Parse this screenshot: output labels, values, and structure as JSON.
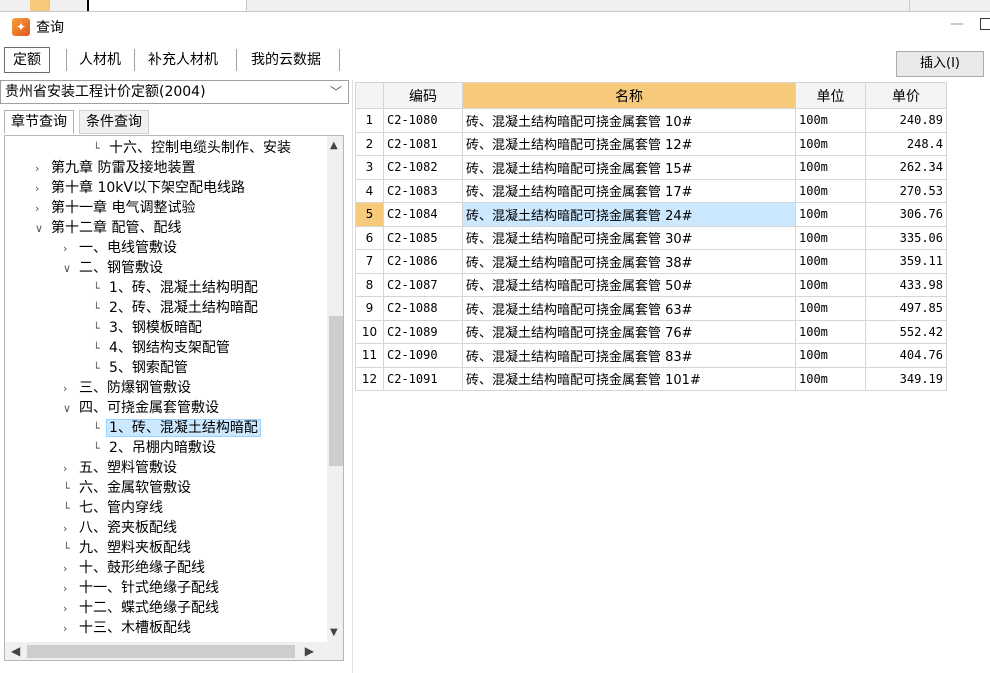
{
  "window": {
    "title": "查询"
  },
  "tabs": [
    "定额",
    "人材机",
    "补充人材机",
    "我的云数据"
  ],
  "insert_button": "插入(I)",
  "dropdown": {
    "value": "贵州省安装工程计价定额(2004)"
  },
  "subtabs": [
    "章节查询",
    "条件查询"
  ],
  "tree": [
    {
      "label": "十六、控制电缆头制作、安装",
      "indent": 3,
      "expander": ""
    },
    {
      "label": "第九章 防雷及接地装置",
      "indent": 1,
      "expander": ">"
    },
    {
      "label": "第十章 10kV以下架空配电线路",
      "indent": 1,
      "expander": ">"
    },
    {
      "label": "第十一章 电气调整试验",
      "indent": 1,
      "expander": ">"
    },
    {
      "label": "第十二章 配管、配线",
      "indent": 1,
      "expander": "v"
    },
    {
      "label": "一、电线管敷设",
      "indent": 2,
      "expander": ">"
    },
    {
      "label": "二、钢管敷设",
      "indent": 2,
      "expander": "v"
    },
    {
      "label": "1、砖、混凝土结构明配",
      "indent": 3,
      "expander": ""
    },
    {
      "label": "2、砖、混凝土结构暗配",
      "indent": 3,
      "expander": ""
    },
    {
      "label": "3、钢模板暗配",
      "indent": 3,
      "expander": ""
    },
    {
      "label": "4、钢结构支架配管",
      "indent": 3,
      "expander": ""
    },
    {
      "label": "5、钢索配管",
      "indent": 3,
      "expander": ""
    },
    {
      "label": "三、防爆钢管敷设",
      "indent": 2,
      "expander": ">"
    },
    {
      "label": "四、可挠金属套管敷设",
      "indent": 2,
      "expander": "v"
    },
    {
      "label": "1、砖、混凝土结构暗配",
      "indent": 3,
      "expander": "",
      "selected": true
    },
    {
      "label": "2、吊棚内暗敷设",
      "indent": 3,
      "expander": ""
    },
    {
      "label": "五、塑料管敷设",
      "indent": 2,
      "expander": ">"
    },
    {
      "label": "六、金属软管敷设",
      "indent": 2,
      "expander": ""
    },
    {
      "label": "七、管内穿线",
      "indent": 2,
      "expander": ""
    },
    {
      "label": "八、瓷夹板配线",
      "indent": 2,
      "expander": ">"
    },
    {
      "label": "九、塑料夹板配线",
      "indent": 2,
      "expander": ""
    },
    {
      "label": "十、鼓形绝缘子配线",
      "indent": 2,
      "expander": ">"
    },
    {
      "label": "十一、针式绝缘子配线",
      "indent": 2,
      "expander": ">"
    },
    {
      "label": "十二、蝶式绝缘子配线",
      "indent": 2,
      "expander": ">"
    },
    {
      "label": "十三、木槽板配线",
      "indent": 2,
      "expander": ">"
    }
  ],
  "table": {
    "headers": [
      "编码",
      "名称",
      "单位",
      "单价"
    ],
    "rows": [
      {
        "n": "1",
        "code": "C2-1080",
        "name": "砖、混凝土结构暗配可挠金属套管 10#",
        "unit": "100m",
        "price": "240.89"
      },
      {
        "n": "2",
        "code": "C2-1081",
        "name": "砖、混凝土结构暗配可挠金属套管 12#",
        "unit": "100m",
        "price": "248.4"
      },
      {
        "n": "3",
        "code": "C2-1082",
        "name": "砖、混凝土结构暗配可挠金属套管 15#",
        "unit": "100m",
        "price": "262.34"
      },
      {
        "n": "4",
        "code": "C2-1083",
        "name": "砖、混凝土结构暗配可挠金属套管 17#",
        "unit": "100m",
        "price": "270.53"
      },
      {
        "n": "5",
        "code": "C2-1084",
        "name": "砖、混凝土结构暗配可挠金属套管 24#",
        "unit": "100m",
        "price": "306.76",
        "selected": true
      },
      {
        "n": "6",
        "code": "C2-1085",
        "name": "砖、混凝土结构暗配可挠金属套管 30#",
        "unit": "100m",
        "price": "335.06"
      },
      {
        "n": "7",
        "code": "C2-1086",
        "name": "砖、混凝土结构暗配可挠金属套管 38#",
        "unit": "100m",
        "price": "359.11"
      },
      {
        "n": "8",
        "code": "C2-1087",
        "name": "砖、混凝土结构暗配可挠金属套管 50#",
        "unit": "100m",
        "price": "433.98"
      },
      {
        "n": "9",
        "code": "C2-1088",
        "name": "砖、混凝土结构暗配可挠金属套管 63#",
        "unit": "100m",
        "price": "497.85"
      },
      {
        "n": "10",
        "code": "C2-1089",
        "name": "砖、混凝土结构暗配可挠金属套管 76#",
        "unit": "100m",
        "price": "552.42"
      },
      {
        "n": "11",
        "code": "C2-1090",
        "name": "砖、混凝土结构暗配可挠金属套管 83#",
        "unit": "100m",
        "price": "404.76"
      },
      {
        "n": "12",
        "code": "C2-1091",
        "name": "砖、混凝土结构暗配可挠金属套管 101#",
        "unit": "100m",
        "price": "349.19"
      }
    ]
  }
}
